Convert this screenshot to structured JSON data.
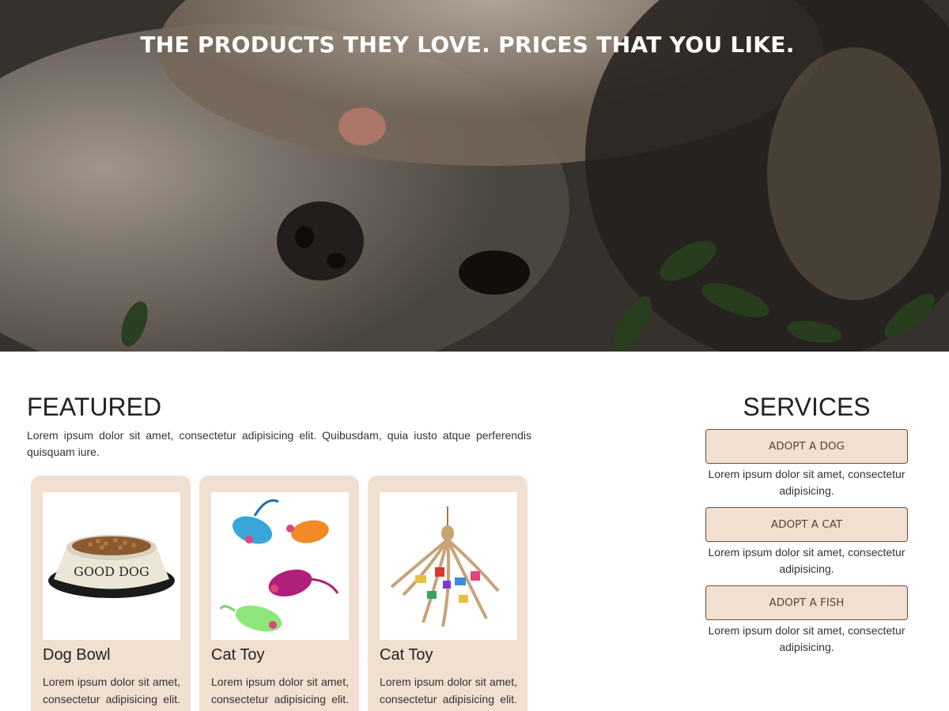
{
  "hero": {
    "title": "THE PRODUCTS THEY LOVE. PRICES THAT YOU LIKE."
  },
  "featured": {
    "title": "FEATURED",
    "description": "Lorem ipsum dolor sit amet, consectetur adipisicing elit. Quibusdam, quia iusto atque perferendis quisquam iure.",
    "cards": [
      {
        "name": "Dog Bowl",
        "image_label": "GOOD DOG",
        "description": "Lorem ipsum dolor sit amet, consectetur adipisicing elit. Nihil"
      },
      {
        "name": "Cat Toy",
        "description": "Lorem ipsum dolor sit amet, consectetur adipisicing elit. Sit"
      },
      {
        "name": "Cat Toy",
        "description": "Lorem ipsum dolor sit amet, consectetur adipisicing elit. Ut"
      }
    ]
  },
  "services": {
    "title": "SERVICES",
    "items": [
      {
        "label": "ADOPT A DOG",
        "description": "Lorem ipsum dolor sit amet, consectetur adipisicing."
      },
      {
        "label": "ADOPT A CAT",
        "description": "Lorem ipsum dolor sit amet, consectetur adipisicing."
      },
      {
        "label": "ADOPT A FISH",
        "description": "Lorem ipsum dolor sit amet, consectetur adipisicing."
      }
    ]
  },
  "colors": {
    "card_background": "#f1dfd0",
    "button_border": "#6b4f45",
    "hero_text": "#ffffff"
  }
}
